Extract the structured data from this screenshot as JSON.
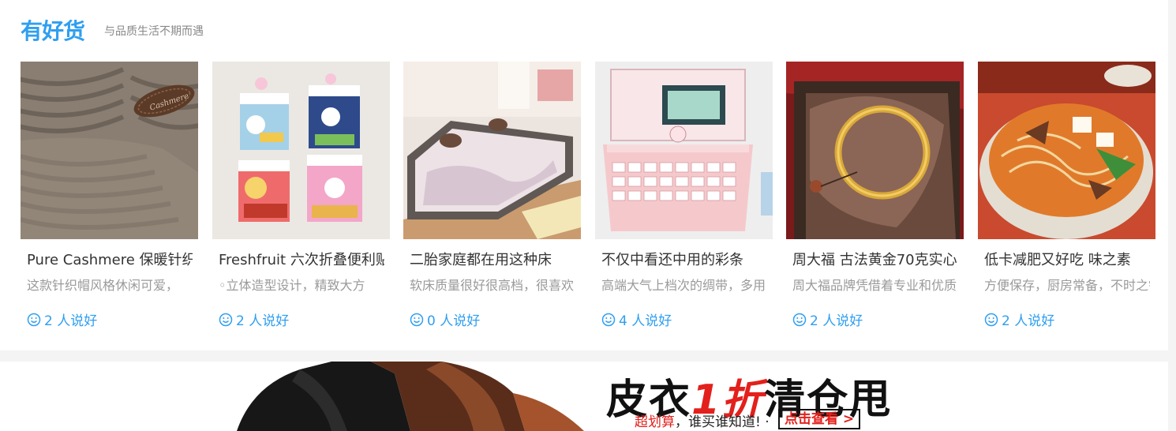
{
  "header": {
    "logo_text_1": "有",
    "logo_text_2": "好",
    "logo_text_3": "货",
    "slogan": "与品质生活不期而遇"
  },
  "items": [
    {
      "title": "Pure Cashmere 保暖针织帽",
      "desc": "这款针织帽风格休闲可爱，",
      "likes": "2 人说好",
      "thumb_icon": "knit-sweater-image"
    },
    {
      "title": "Freshfruit 六次折叠便利贴",
      "desc": "◦立体造型设计，精致大方",
      "likes": "2 人说好",
      "thumb_icon": "snoopy-sticky-notes-image"
    },
    {
      "title": "二胎家庭都在用这种床",
      "desc": "软床质量很好很高档，很喜欢",
      "likes": "0 人说好",
      "thumb_icon": "family-bed-image"
    },
    {
      "title": "不仅中看还中用的彩条",
      "desc": "高端大气上档次的绸带，多用",
      "likes": "4 人说好",
      "thumb_icon": "pink-label-maker-image"
    },
    {
      "title": "周大福 古法黄金70克实心",
      "desc": "周大福品牌凭借着专业和优质",
      "likes": "2 人说好",
      "thumb_icon": "gold-bangle-image"
    },
    {
      "title": "低卡减肥又好吃 味之素",
      "desc": "方便保存，厨房常备，不时之需",
      "likes": "2 人说好",
      "thumb_icon": "noodle-hotpot-image"
    }
  ],
  "banner": {
    "title_part1": "皮衣",
    "title_red": "1折",
    "title_part2": "清仓甩",
    "sub_red": "超划算",
    "sub_rest": "，谁买谁知道! ·",
    "button": "点击查看 >"
  },
  "colors": {
    "accent": "#2f9ff0",
    "logo_dot": "#ffb400",
    "banner_red": "#e3201c"
  }
}
